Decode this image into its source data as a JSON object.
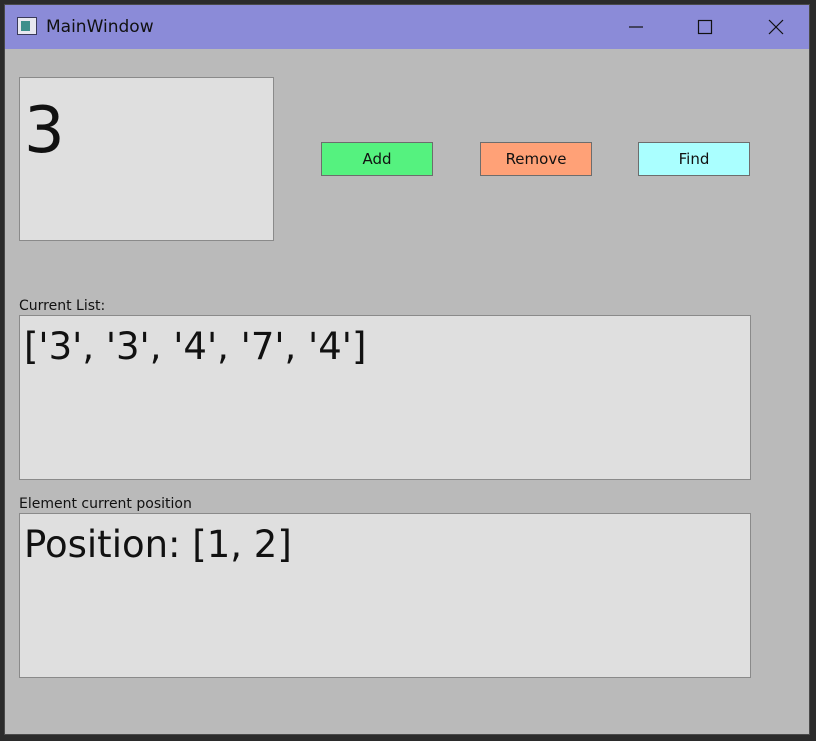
{
  "window": {
    "title": "MainWindow",
    "titlebar_color": "#8b8bd8",
    "background_color": "#bababa",
    "controls": [
      "minimize-icon",
      "maximize-icon",
      "close-icon"
    ]
  },
  "display": {
    "value": "3"
  },
  "buttons": {
    "add_label": "Add",
    "add_color": "#55f27f",
    "remove_label": "Remove",
    "remove_color": "#ffa177",
    "find_label": "Find",
    "find_color": "#aaffff"
  },
  "current_list": {
    "label": "Current List:",
    "value": "['3', '3', '4', '7', '4']"
  },
  "position": {
    "label": "Element current position",
    "value": "Position: [1, 2]"
  }
}
